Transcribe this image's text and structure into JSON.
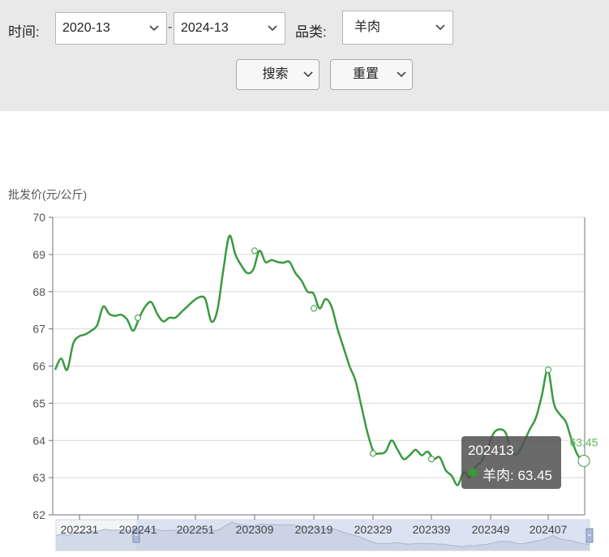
{
  "filters": {
    "time_label": "时间:",
    "start_value": "2020-13",
    "separator": "-",
    "end_value": "2024-13",
    "category_label": "品类:",
    "category_value": "羊肉",
    "search_label": "搜索",
    "reset_label": "重置"
  },
  "tooltip": {
    "title": "202413",
    "series_text": "羊肉: 63.45"
  },
  "colors": {
    "line": "#3a9a3f",
    "tooltip_bg": "#505050",
    "filter_bg": "#e9e9e9"
  },
  "chart_data": {
    "type": "line",
    "ylabel": "批发价(元/公斤)",
    "ylim": [
      62,
      70
    ],
    "yticks": [
      62,
      63,
      64,
      65,
      66,
      67,
      68,
      69,
      70
    ],
    "xtick_labels": [
      "202231",
      "202241",
      "202251",
      "202309",
      "202319",
      "202329",
      "202339",
      "202349",
      "202407"
    ],
    "grid": true,
    "series": [
      {
        "name": "羊肉",
        "values": [
          65.9,
          66.2,
          65.9,
          66.6,
          66.8,
          66.85,
          66.95,
          67.1,
          67.6,
          67.4,
          67.35,
          67.38,
          67.25,
          66.95,
          67.3,
          67.6,
          67.72,
          67.4,
          67.2,
          67.3,
          67.3,
          67.45,
          67.6,
          67.75,
          67.85,
          67.8,
          67.2,
          67.5,
          68.6,
          69.5,
          69.0,
          68.7,
          68.5,
          68.6,
          69.1,
          68.8,
          68.85,
          68.8,
          68.78,
          68.8,
          68.5,
          68.3,
          68.0,
          67.95,
          67.55,
          67.8,
          67.6,
          67.0,
          66.5,
          66.0,
          65.6,
          64.9,
          64.2,
          63.7,
          63.65,
          63.7,
          64.0,
          63.75,
          63.5,
          63.6,
          63.75,
          63.6,
          63.7,
          63.5,
          63.55,
          63.2,
          63.05,
          62.8,
          63.15,
          63.0,
          63.3,
          63.45,
          63.8,
          64.2,
          64.3,
          64.2,
          63.7,
          63.65,
          63.95,
          64.3,
          64.6,
          65.2,
          65.9,
          65.0,
          64.7,
          64.5,
          64.0,
          63.6,
          63.45
        ]
      }
    ],
    "labeled_points": [
      {
        "x": "202241",
        "y": 67.3
      },
      {
        "x": "202309",
        "y": 69.1
      },
      {
        "x": "202319",
        "y": 67.55
      },
      {
        "x": "202329",
        "y": 63.65
      },
      {
        "x": "202339",
        "y": 63.5
      },
      {
        "x": "202407",
        "y": 65.9
      }
    ],
    "end_label": "63.45"
  }
}
